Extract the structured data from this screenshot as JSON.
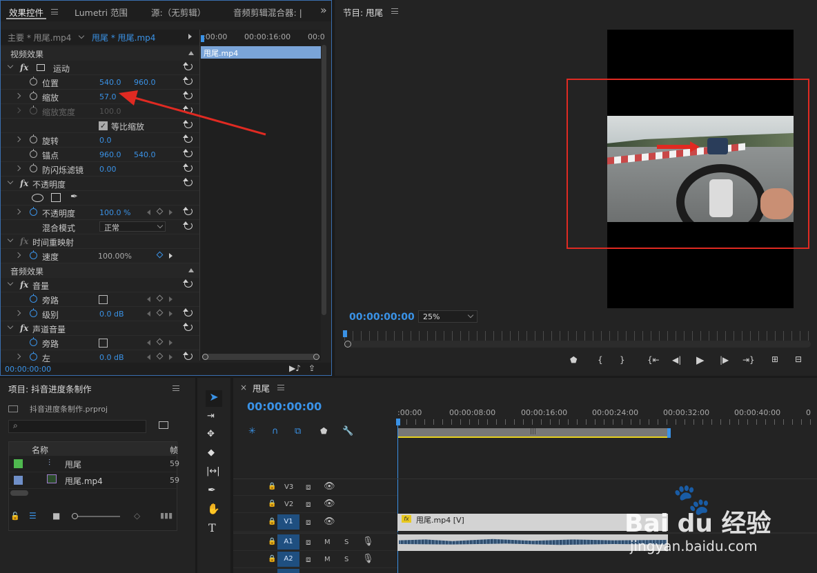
{
  "effect_controls": {
    "tabs": [
      "效果控件",
      "Lumetri 范围",
      "源:（无剪辑）",
      "音频剪辑混合器: |"
    ],
    "more": "»",
    "source_master": "主要 * 甩尾.mp4",
    "source_clip": "甩尾 * 甩尾.mp4",
    "mini_timeline": {
      "t0": ":00:00",
      "t1": "00:00:16:00",
      "t2": "00:0",
      "clip_label": "甩尾.mp4"
    },
    "video_effects_label": "视频效果",
    "motion": {
      "label": "运动",
      "fx": "fx"
    },
    "position": {
      "label": "位置",
      "x": "540.0",
      "y": "960.0"
    },
    "scale": {
      "label": "缩放",
      "value": "57.0"
    },
    "scale_width": {
      "label": "缩放宽度",
      "value": "100.0"
    },
    "uniform_scale": {
      "label": "等比缩放",
      "checked": true
    },
    "rotation": {
      "label": "旋转",
      "value": "0.0"
    },
    "anchor": {
      "label": "锚点",
      "x": "960.0",
      "y": "540.0"
    },
    "anti_flicker": {
      "label": "防闪烁滤镜",
      "value": "0.00"
    },
    "opacity_group": {
      "label": "不透明度",
      "fx": "fx"
    },
    "opacity": {
      "label": "不透明度",
      "value": "100.0 %"
    },
    "blend_mode": {
      "label": "混合模式",
      "value": "正常"
    },
    "time_remap": {
      "label": "时间重映射",
      "fx": "fx"
    },
    "speed": {
      "label": "速度",
      "value": "100.00%"
    },
    "audio_effects_label": "音频效果",
    "volume": {
      "label": "音量",
      "fx": "fx"
    },
    "bypass1": {
      "label": "旁路"
    },
    "level": {
      "label": "级别",
      "value": "0.0 dB"
    },
    "channel_volume": {
      "label": "声道音量",
      "fx": "fx"
    },
    "bypass2": {
      "label": "旁路"
    },
    "left": {
      "label": "左",
      "value": "0.0 dB"
    },
    "timecode": "00:00:00:00"
  },
  "program": {
    "title": "节目: 甩尾",
    "timecode": "00:00:00:00",
    "zoom": "25%"
  },
  "project": {
    "title": "项目: 抖音进度条制作",
    "file": "抖音进度条制作.prproj",
    "search_placeholder": "",
    "col_name": "名称",
    "col_fps": "帧",
    "items": [
      {
        "name": "甩尾",
        "fps": "59",
        "color": "#4fb84f"
      },
      {
        "name": "甩尾.mp4",
        "fps": "59",
        "color": "#6f8fc8"
      }
    ]
  },
  "timeline": {
    "close": "×",
    "title": "甩尾",
    "timecode": "00:00:00:00",
    "ruler": [
      ":00:00",
      "00:00:08:00",
      "00:00:16:00",
      "00:00:24:00",
      "00:00:32:00",
      "00:00:40:00",
      "0"
    ],
    "tracks": [
      "V3",
      "V2",
      "V1",
      "A1",
      "A2"
    ],
    "clip_v1": "甩尾.mp4 [V]",
    "m": "M",
    "s": "S"
  },
  "watermark": {
    "brand": "Bai du 经验",
    "url": "jingyan.baidu.com"
  },
  "colors": {
    "accent": "#3a92e6",
    "red": "#e02a22",
    "yellow": "#e8d21e"
  }
}
